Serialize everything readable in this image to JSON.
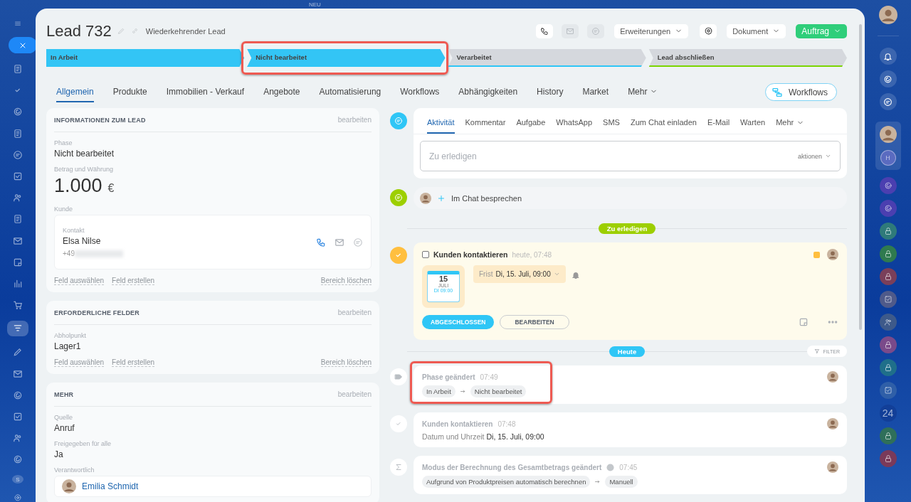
{
  "top_badge": "NEU",
  "left_nav": {
    "badge": "S"
  },
  "header": {
    "title": "Lead 732",
    "subtitle": "Wiederkehrender Lead",
    "icon_buttons": [
      {
        "kind": "phone",
        "disabled": false
      },
      {
        "kind": "mail",
        "disabled": true
      },
      {
        "kind": "chat",
        "disabled": true
      }
    ],
    "extensions": "Erweiterungen",
    "document": "Dokument",
    "primary": "Auftrag"
  },
  "stages": [
    {
      "label": "In Arbeit",
      "active": true,
      "color": "#2fc6f6",
      "highlighted": false
    },
    {
      "label": "Nicht bearbeitet",
      "active": true,
      "color": "#2fc6f6",
      "highlighted": true
    },
    {
      "label": "Verarbeitet",
      "active": false,
      "color": "#2fc6f6",
      "highlighted": false
    },
    {
      "label": "Lead abschließen",
      "active": false,
      "color": "#7bd500",
      "highlighted": false
    }
  ],
  "tabs": [
    {
      "label": "Allgemein",
      "selected": true
    },
    {
      "label": "Produkte",
      "selected": false
    },
    {
      "label": "Immobilien - Verkauf",
      "selected": false
    },
    {
      "label": "Angebote",
      "selected": false
    },
    {
      "label": "Automatisierung",
      "selected": false
    },
    {
      "label": "Workflows",
      "selected": false
    },
    {
      "label": "Abhängigkeiten",
      "selected": false
    },
    {
      "label": "History",
      "selected": false
    },
    {
      "label": "Market",
      "selected": false
    }
  ],
  "tabs_more": "Mehr",
  "workflows_button": "Workflows",
  "sections": [
    {
      "title": "INFORMATIONEN ZUM LEAD",
      "edit": "bearbeiten",
      "fields": [
        {
          "kind": "text",
          "label": "Phase",
          "value": "Nicht bearbeitet"
        },
        {
          "kind": "amount",
          "label": "Betrag und Währung",
          "value": "1.000",
          "currency": "€"
        },
        {
          "kind": "contact",
          "label": "Kunde",
          "type": "Kontakt",
          "name": "Elsa Nilse",
          "phone": "+49"
        }
      ],
      "links": [
        "Feld auswählen",
        "Feld erstellen"
      ],
      "clear": "Bereich löschen"
    },
    {
      "title": "ERFORDERLICHE FELDER",
      "edit": "bearbeiten",
      "fields": [
        {
          "kind": "text",
          "label": "Abholpunkt",
          "value": "Lager1"
        }
      ],
      "links": [
        "Feld auswählen",
        "Feld erstellen"
      ],
      "clear": "Bereich löschen"
    },
    {
      "title": "MEHR",
      "edit": "bearbeiten",
      "fields": [
        {
          "kind": "text",
          "label": "Quelle",
          "value": "Anruf"
        },
        {
          "kind": "text",
          "label": "Freigegeben für alle",
          "value": "Ja"
        },
        {
          "kind": "person",
          "label": "Verantwortlich",
          "name": "Emilia Schmidt"
        }
      ]
    }
  ],
  "composer": {
    "tabs": [
      {
        "label": "Aktivität",
        "selected": true
      },
      {
        "label": "Kommentar",
        "selected": false
      },
      {
        "label": "Aufgabe",
        "selected": false
      },
      {
        "label": "WhatsApp",
        "selected": false
      },
      {
        "label": "SMS",
        "selected": false
      },
      {
        "label": "Zum Chat einladen",
        "selected": false
      },
      {
        "label": "E-Mail",
        "selected": false
      },
      {
        "label": "Warten",
        "selected": false
      }
    ],
    "more": "Mehr",
    "placeholder": "Zu erledigen",
    "actions": "aktionen"
  },
  "chat_row": "Im Chat besprechen",
  "todo_divider": "Zu erledigen",
  "task": {
    "title": "Kunden kontaktieren",
    "time": "heute, 07:48",
    "checked": false,
    "calendar": {
      "day": "15",
      "month": "JULI",
      "time": "DI 09:00"
    },
    "deadline_label": "Frist",
    "deadline": "Di, 15. Juli, 09:00",
    "buttons": [
      "ABGESCHLOSSEN",
      "BEARBEITEN"
    ]
  },
  "today_divider": "Heute",
  "filter": "FILTER",
  "history": [
    {
      "kind": "stage",
      "title": "Phase geändert",
      "time": "07:49",
      "from": "In Arbeit",
      "to": "Nicht bearbeitet",
      "highlighted": true
    },
    {
      "kind": "task",
      "title": "Kunden kontaktieren",
      "time": "07:48",
      "label": "Datum und Uhrzeit",
      "value": "Di, 15. Juli, 09:00"
    },
    {
      "kind": "sum",
      "title": "Modus der Berechnung des Gesamtbetrags geändert",
      "time": "07:45",
      "help": true,
      "from": "Aufgrund von Produktpreisen automatisch berechnen",
      "to": "Manuell"
    }
  ],
  "right_rail": {
    "initial": "H",
    "counter": "24"
  }
}
